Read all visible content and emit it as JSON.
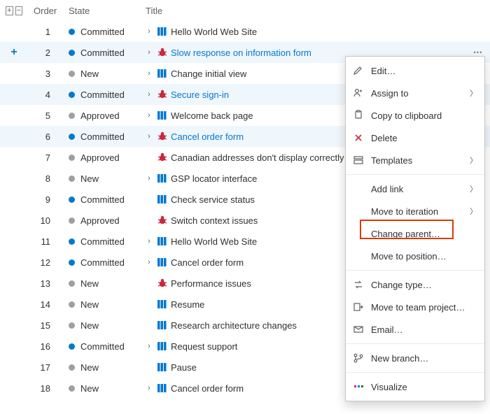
{
  "columns": {
    "order": "Order",
    "state": "State",
    "title": "Title"
  },
  "states": {
    "committed": "Committed",
    "new": "New",
    "approved": "Approved"
  },
  "rows": [
    {
      "order": 1,
      "state": "committed",
      "dot": "blue",
      "type": "pbi",
      "title": "Hello World Web Site",
      "chev": true
    },
    {
      "order": 2,
      "state": "committed",
      "dot": "blue",
      "type": "bug",
      "title": "Slow response on information form",
      "chev": true,
      "selected": true,
      "link": true,
      "showActions": true,
      "showPlus": true
    },
    {
      "order": 3,
      "state": "new",
      "dot": "grey",
      "type": "pbi",
      "title": "Change initial view",
      "chev": true
    },
    {
      "order": 4,
      "state": "committed",
      "dot": "blue",
      "type": "bug",
      "title": "Secure sign-in",
      "chev": true,
      "hovered": true,
      "link": true,
      "showActions": true
    },
    {
      "order": 5,
      "state": "approved",
      "dot": "grey",
      "type": "pbi",
      "title": "Welcome back page",
      "chev": true
    },
    {
      "order": 6,
      "state": "committed",
      "dot": "blue",
      "type": "bug",
      "title": "Cancel order form",
      "chev": true,
      "hovered": true,
      "link": true,
      "showActions": true
    },
    {
      "order": 7,
      "state": "approved",
      "dot": "grey",
      "type": "bug",
      "title": "Canadian addresses don't display correctly"
    },
    {
      "order": 8,
      "state": "new",
      "dot": "grey",
      "type": "pbi",
      "title": "GSP locator interface",
      "chev": true
    },
    {
      "order": 9,
      "state": "committed",
      "dot": "blue",
      "type": "pbi",
      "title": "Check service status"
    },
    {
      "order": 10,
      "state": "approved",
      "dot": "grey",
      "type": "bug",
      "title": "Switch context issues"
    },
    {
      "order": 11,
      "state": "committed",
      "dot": "blue",
      "type": "pbi",
      "title": "Hello World Web Site",
      "chev": true
    },
    {
      "order": 12,
      "state": "committed",
      "dot": "blue",
      "type": "pbi",
      "title": "Cancel order form",
      "chev": true
    },
    {
      "order": 13,
      "state": "new",
      "dot": "grey",
      "type": "bug",
      "title": "Performance issues"
    },
    {
      "order": 14,
      "state": "new",
      "dot": "grey",
      "type": "pbi",
      "title": "Resume"
    },
    {
      "order": 15,
      "state": "new",
      "dot": "grey",
      "type": "pbi",
      "title": "Research architecture changes"
    },
    {
      "order": 16,
      "state": "committed",
      "dot": "blue",
      "type": "pbi",
      "title": "Request support",
      "chev": true
    },
    {
      "order": 17,
      "state": "new",
      "dot": "grey",
      "type": "pbi",
      "title": "Pause"
    },
    {
      "order": 18,
      "state": "new",
      "dot": "grey",
      "type": "pbi",
      "title": "Cancel order form",
      "chev": true
    }
  ],
  "menu": {
    "edit": "Edit…",
    "assign_to": "Assign to",
    "copy": "Copy to clipboard",
    "delete": "Delete",
    "templates": "Templates",
    "add_link": "Add link",
    "move_iter": "Move to iteration",
    "change_parent": "Change parent…",
    "move_pos": "Move to position…",
    "change_type": "Change type…",
    "move_team": "Move to team project…",
    "email": "Email…",
    "new_branch": "New branch…",
    "visualize": "Visualize"
  }
}
